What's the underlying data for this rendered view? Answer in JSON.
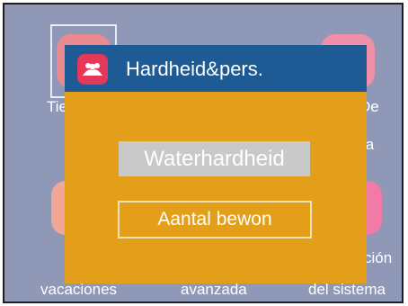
{
  "background": {
    "labels_top": [
      "Tie",
      "De",
      "la"
    ],
    "labels_bottom": [
      "vacaciones",
      "avanzada",
      "del sistema"
    ],
    "labels_mid": [
      "ción"
    ]
  },
  "dialog": {
    "title": "Hardheid&pers.",
    "icon": "people-icon",
    "options": [
      "Waterhardheid",
      "Aantal bewon"
    ]
  },
  "colors": {
    "screen_bg": "#9098b8",
    "dialog_bg": "#e39e1a",
    "header_bg": "#1e5a93",
    "icon_bg": "#e5375a",
    "option_selected_bg": "#c9c9c9"
  }
}
